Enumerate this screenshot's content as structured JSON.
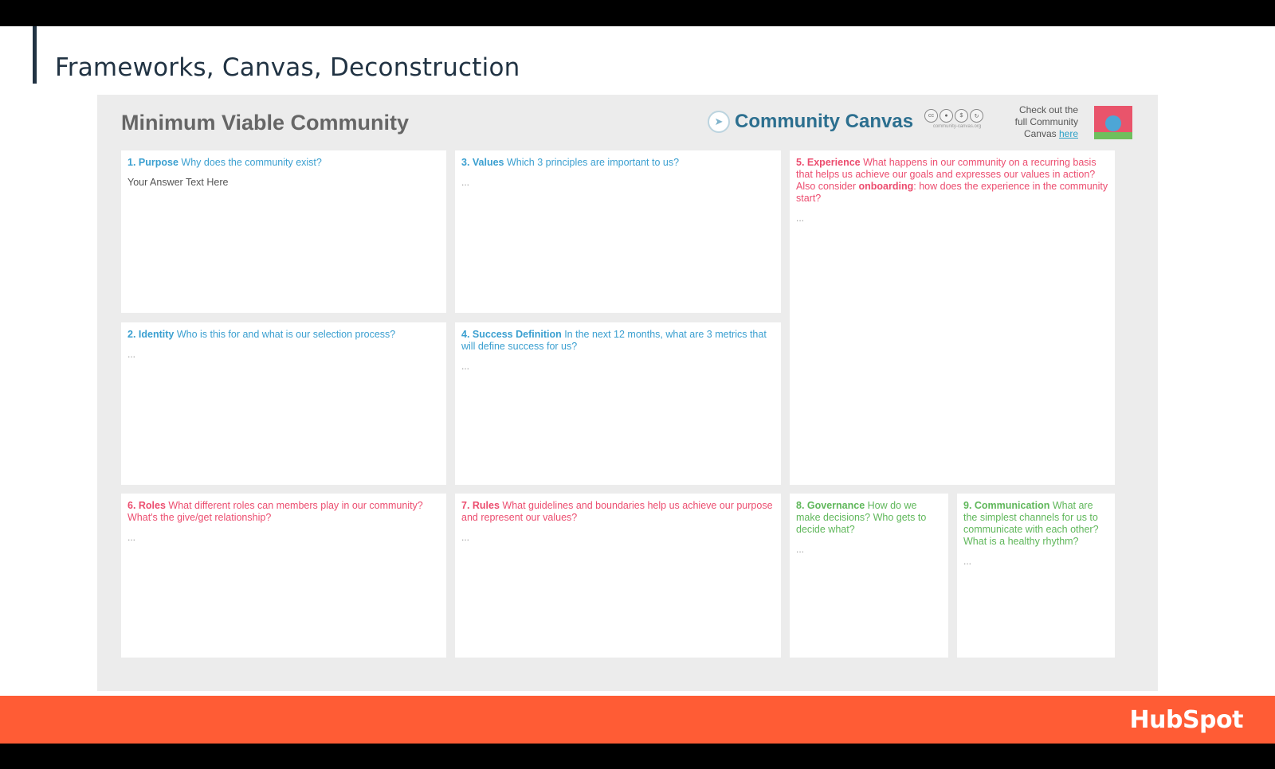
{
  "slide": {
    "title": "Frameworks, Canvas, Deconstruction",
    "footer_brand": "HubSpot"
  },
  "canvas": {
    "title": "Minimum Viable Community",
    "brand_name": "Community Canvas",
    "brand_icon": "compass-icon",
    "license_icons": [
      "cc",
      "by",
      "nc",
      "sa"
    ],
    "license_url": "community-canvas.org",
    "checkout_line1": "Check out the",
    "checkout_line2": "full Community",
    "checkout_line3": "Canvas",
    "checkout_link": "here",
    "thumbnail_colors": {
      "top": "#e9546b",
      "bottom": "#6fbf5d",
      "center": "#4da6d6"
    }
  },
  "colors": {
    "blue": "#3a9fd0",
    "pink": "#ec4d6f",
    "green": "#5fb75a",
    "footer": "#ff5c35",
    "title": "#213343"
  },
  "boxes": {
    "purpose": {
      "num": "1. Purpose",
      "question": " Why does the community exist?",
      "answer": "Your Answer Text Here"
    },
    "identity": {
      "num": "2. Identity",
      "question": " Who is this for and what is our selection process?",
      "answer": "..."
    },
    "values": {
      "num": "3. Values",
      "question": " Which 3 principles are important to us?",
      "answer": "..."
    },
    "success": {
      "num": "4. Success Definition",
      "question": " In the next 12 months, what are 3 metrics that will define success for us?",
      "answer": "..."
    },
    "experience": {
      "num": "5. Experience",
      "question": " What happens in our community on a recurring basis that helps us achieve our goals and expresses our values in action? Also consider ",
      "bold": "onboarding",
      "question2": ": how does the experience in the community start?",
      "answer": "..."
    },
    "roles": {
      "num": "6. Roles",
      "question": " What different roles can members play in our community? What's the give/get relationship?",
      "answer": "..."
    },
    "rules": {
      "num": "7. Rules",
      "question": " What guidelines and boundaries help us achieve our purpose and represent our values?",
      "answer": "..."
    },
    "governance": {
      "num": "8. Governance",
      "question": " How do we make decisions? Who gets to decide what?",
      "answer": "..."
    },
    "communication": {
      "num": "9. Communication",
      "question": " What are the simplest channels for us to communicate with each other? What is a healthy rhythm?",
      "answer": "..."
    }
  }
}
